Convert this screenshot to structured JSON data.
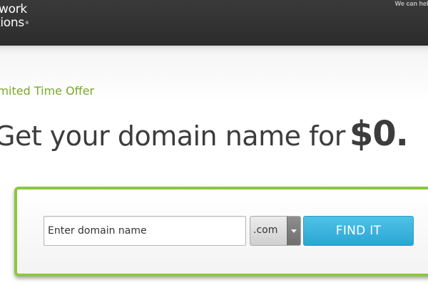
{
  "header": {
    "logo_line_1": "work",
    "logo_line_2": "tions",
    "logo_trademark": "®",
    "help_text": "We can help"
  },
  "offer": {
    "label": "imited Time Offer",
    "headline": "Get your domain name for",
    "price": "$0."
  },
  "search": {
    "domain_input_placeholder": "Enter domain name",
    "domain_input_value": "",
    "tld_selected": ".com",
    "find_button_label": "FIND IT"
  },
  "colors": {
    "header_bg": "#2f2f2f",
    "accent_green": "#8dc63f",
    "offer_text_green": "#7aa928",
    "button_blue": "#35b0dc",
    "headline_text": "#3c3c3c"
  },
  "icons": {
    "tld_dropdown": "chevron-down-icon"
  }
}
